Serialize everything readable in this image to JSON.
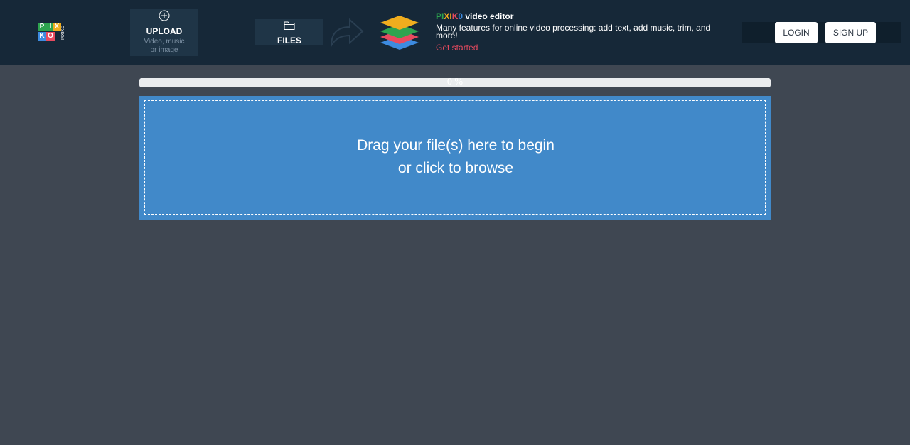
{
  "logo": {
    "cells": [
      "P",
      "I",
      "X",
      "I",
      "K",
      "O"
    ],
    "vertical_text": "PIXIKO"
  },
  "nav": {
    "upload": {
      "icon": "plus-circle-icon",
      "label": "UPLOAD",
      "sub1": "Video, music",
      "sub2": "or image"
    },
    "files": {
      "icon": "folder-icon",
      "label": "FILES"
    }
  },
  "promo": {
    "brand_letters": [
      "PI",
      "XI",
      "K",
      "0"
    ],
    "title_suffix": " video editor",
    "description": "Many features for online video processing: add text, add music, trim, and more!",
    "link": "Get started"
  },
  "auth": {
    "login": "LOGIN",
    "signup": "SIGN UP"
  },
  "upload_progress": {
    "value": 0,
    "text": "0 %"
  },
  "dropzone": {
    "line1": "Drag your file(s) here to begin",
    "line2": "or click to browse"
  },
  "colors": {
    "topbar": "#162838",
    "page_bg": "#3f4752",
    "accent_blue": "#4189c9",
    "link_red": "#e84a5f"
  }
}
